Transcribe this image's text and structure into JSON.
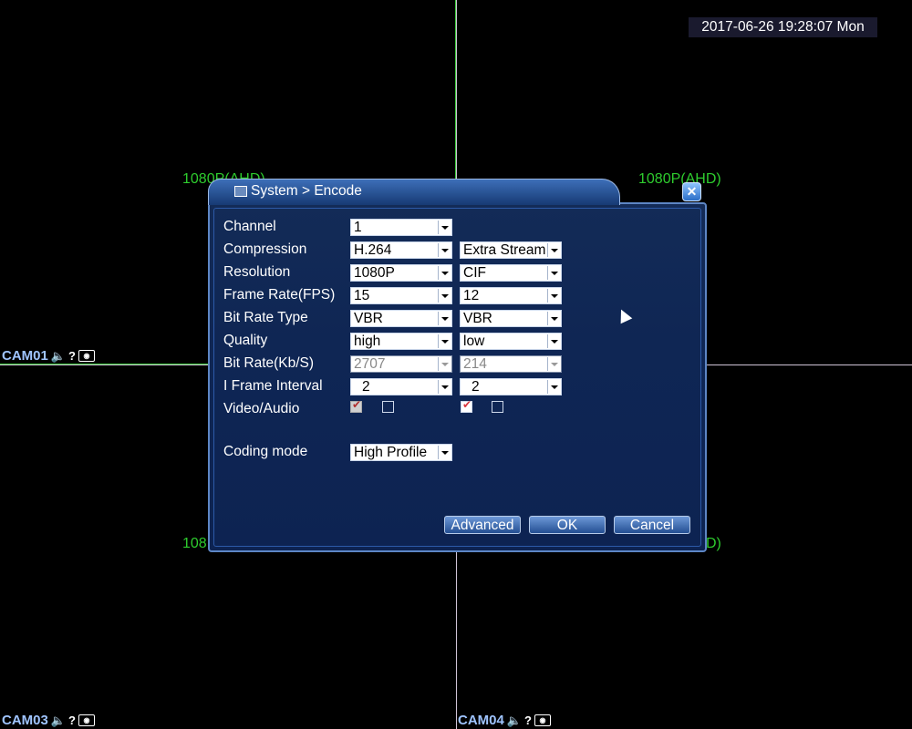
{
  "datetime": "2017-06-26 19:28:07 Mon",
  "resolutions": [
    "1080P(AHD)",
    "1080P(AHD)",
    "108",
    "D)"
  ],
  "cameras": [
    {
      "name": "CAM01"
    },
    {
      "name": "CAM03"
    },
    {
      "name": "CAM04"
    }
  ],
  "icons": {
    "speaker": "speaker-icon",
    "help": "help-icon",
    "snapshot": "camera-icon"
  },
  "dialog": {
    "title": "System > Encode",
    "rows": {
      "channel": {
        "label": "Channel",
        "main": "1"
      },
      "compression": {
        "label": "Compression",
        "main": "H.264",
        "extra": "Extra Stream"
      },
      "resolution": {
        "label": "Resolution",
        "main": "1080P",
        "extra": "CIF"
      },
      "frame_rate": {
        "label": "Frame Rate(FPS)",
        "main": "15",
        "extra": "12"
      },
      "bit_rate_type": {
        "label": "Bit Rate Type",
        "main": "VBR",
        "extra": "VBR"
      },
      "quality": {
        "label": "Quality",
        "main": "high",
        "extra": "low"
      },
      "bit_rate": {
        "label": "Bit Rate(Kb/S)",
        "main": "2707",
        "extra": "214"
      },
      "i_frame": {
        "label": "I Frame Interval",
        "main": "2",
        "extra": "2"
      },
      "video_audio": {
        "label": "Video/Audio",
        "main_video": true,
        "main_audio": false,
        "extra_video": true,
        "extra_audio": false
      },
      "coding_mode": {
        "label": "Coding mode",
        "main": "High Profile"
      }
    },
    "buttons": {
      "advanced": "Advanced",
      "ok": "OK",
      "cancel": "Cancel"
    }
  },
  "colors": {
    "accent": "#2b6ec7",
    "resolution_text": "#2ecc2e",
    "cam_label": "#9fc4ff"
  }
}
